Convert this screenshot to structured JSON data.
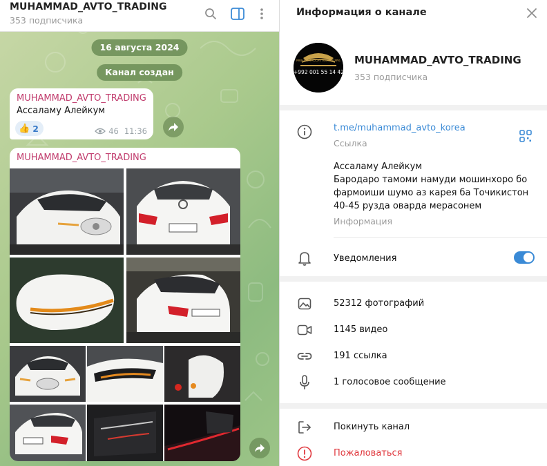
{
  "chat": {
    "title": "MUHAMMAD_AVTO_TRADING",
    "subtitle": "353 подписчика",
    "date_pill": "16 августа 2024",
    "service_pill": "Канал создан",
    "messages": [
      {
        "sender": "MUHAMMAD_AVTO_TRADING",
        "text": "Ассаламу Алейкум",
        "reaction_emoji": "👍",
        "reaction_count": "2",
        "views": "46",
        "time": "11:36"
      },
      {
        "sender": "MUHAMMAD_AVTO_TRADING",
        "photos": [
          "car-front-photo",
          "car-rear-photo",
          "mirror-indicator-photo",
          "car-front-angle-photo",
          "car-front-photo",
          "headlight-photo",
          "mirror-photo",
          "car-rear-photo",
          "door-interior-photo",
          "door-ambient-photo"
        ]
      }
    ]
  },
  "info": {
    "title": "Информация о канале",
    "avatar_text": "MUHAMMAD_AVTO_TRADING",
    "avatar_phone": "+992 001 55 14 42",
    "channel_name": "MUHAMMAD_AVTO_TRADING",
    "subscribers": "353 подписчика",
    "link": "t.me/muhammad_avto_korea",
    "link_label": "Ссылка",
    "description_lines": [
      "Ассаламу Алейкум",
      "Бародаро тамоми намуди мошинхоро бо",
      "фармоиши шумо аз карея ба Точикистон",
      "40-45 рузда оварда мерасонем"
    ],
    "description_label": "Информация",
    "notifications_label": "Уведомления",
    "notifications_on": true,
    "media": {
      "photos": "52312 фотографий",
      "videos": "1145 видео",
      "links": "191 ссылка",
      "voice": "1 голосовое сообщение"
    },
    "leave": "Покинуть канал",
    "report": "Пожаловаться"
  },
  "colors": {
    "accent": "#3a8ad6",
    "sender": "#c13c6d",
    "danger": "#e0383e"
  }
}
